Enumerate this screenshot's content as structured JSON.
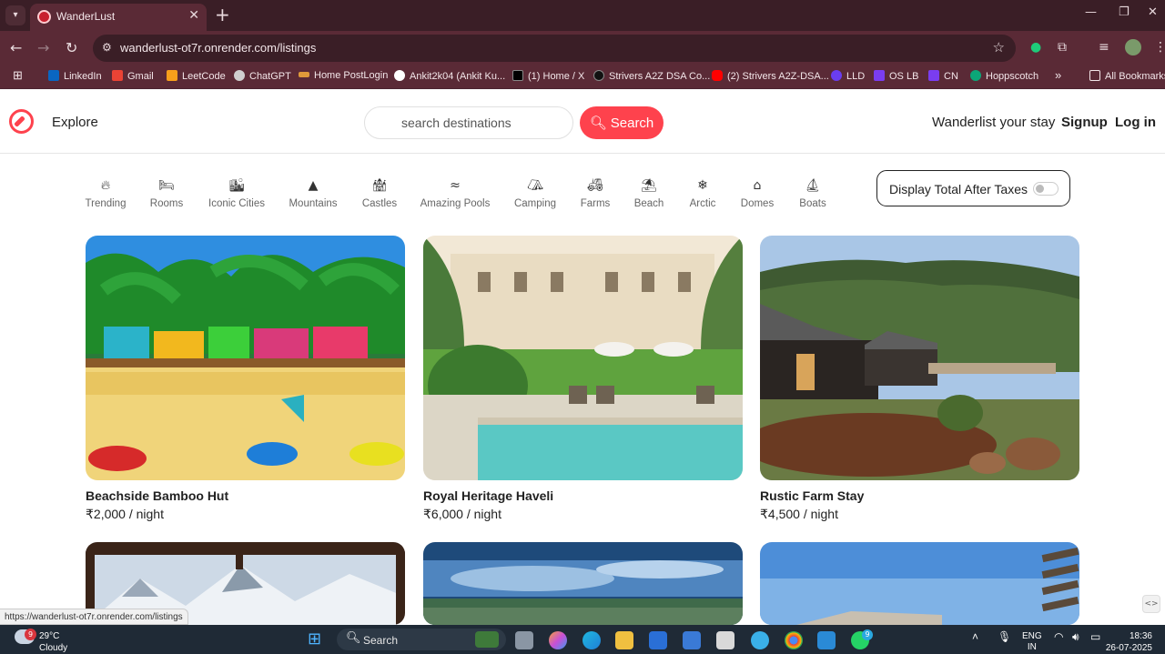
{
  "browser": {
    "tab_title": "WanderLust",
    "url": "wanderlust-ot7r.onrender.com/listings",
    "bookmarks": [
      {
        "label": "LinkedIn",
        "color": "#0a66c2"
      },
      {
        "label": "Gmail",
        "color": "#ea4335"
      },
      {
        "label": "LeetCode",
        "color": "#f89f1b"
      },
      {
        "label": "ChatGPT",
        "color": "#cfcfcf"
      },
      {
        "label": "Home PostLogin",
        "color": "#e09a3a"
      },
      {
        "label": "Ankit2k04 (Ankit Ku...",
        "color": "#ffffff"
      },
      {
        "label": "(1) Home / X",
        "color": "#000000"
      },
      {
        "label": "Strivers A2Z DSA Co...",
        "color": "#111111"
      },
      {
        "label": "(2) Strivers A2Z-DSA...",
        "color": "#ff0000"
      },
      {
        "label": "LLD",
        "color": "#6a3df0"
      },
      {
        "label": "OS LB",
        "color": "#7a3df0"
      },
      {
        "label": "CN",
        "color": "#7a3df0"
      },
      {
        "label": "Hoppscotch",
        "color": "#0ca678"
      }
    ],
    "all_bookmarks": "All Bookmarks",
    "status_url": "https://wanderlust-ot7r.onrender.com/listings"
  },
  "navbar": {
    "explore": "Explore",
    "search_placeholder": "search destinations",
    "search_button": "Search",
    "host_link": "Wanderlist your stay",
    "signup": "Signup",
    "login": "Log in",
    "brand_color": "#fe424d"
  },
  "filters": [
    {
      "label": "Trending",
      "icon": "fire-icon",
      "glyph": "🔥"
    },
    {
      "label": "Rooms",
      "icon": "bed-icon",
      "glyph": "🛏"
    },
    {
      "label": "Iconic Cities",
      "icon": "city-icon",
      "glyph": "🏙"
    },
    {
      "label": "Mountains",
      "icon": "mountain-icon",
      "glyph": "▲"
    },
    {
      "label": "Castles",
      "icon": "castle-icon",
      "glyph": "🏰"
    },
    {
      "label": "Amazing Pools",
      "icon": "pool-icon",
      "glyph": "🏊"
    },
    {
      "label": "Camping",
      "icon": "campground-icon",
      "glyph": "⛺"
    },
    {
      "label": "Farms",
      "icon": "tractor-icon",
      "glyph": "🚜"
    },
    {
      "label": "Beach",
      "icon": "umbrella-beach-icon",
      "glyph": "⛱"
    },
    {
      "label": "Arctic",
      "icon": "snowflake-icon",
      "glyph": "❄"
    },
    {
      "label": "Domes",
      "icon": "igloo-icon",
      "glyph": "⌂"
    },
    {
      "label": "Boats",
      "icon": "sailboat-icon",
      "glyph": "⛵"
    }
  ],
  "tax_toggle": {
    "label": "Display Total After Taxes",
    "on": false
  },
  "listings": [
    {
      "title": "Beachside Bamboo Hut",
      "price": "₹2,000 / night"
    },
    {
      "title": "Royal Heritage Haveli",
      "price": "₹6,000 / night"
    },
    {
      "title": "Rustic Farm Stay",
      "price": "₹4,500 / night"
    }
  ],
  "taskbar": {
    "weather_temp": "29°C",
    "weather_desc": "Cloudy",
    "weather_badge": "9",
    "search_label": "Search",
    "lang_1": "ENG",
    "lang_2": "IN",
    "time": "18:36",
    "date": "26-07-2025",
    "whatsapp_badge": "9"
  }
}
